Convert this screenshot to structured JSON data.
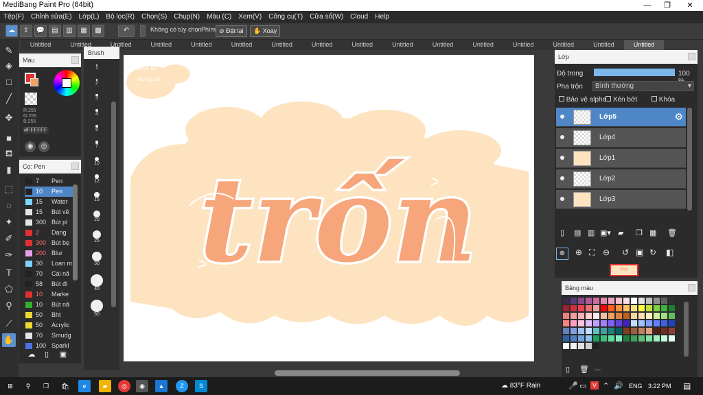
{
  "window": {
    "title": "MediBang Paint Pro (64bit)"
  },
  "menu": [
    "Tệp(F)",
    "Chỉnh sửa(E)",
    "Lớp(L)",
    "Bộ lọc(R)",
    "Chọn(S)",
    "Chụp(N)",
    "Màu (C)",
    "Xem(V)",
    "Công cụ(T)",
    "Cửa sổ(W)",
    "Cloud",
    "Help"
  ],
  "toolbar": {
    "snap_label": "Không có tùy chọn",
    "key_label": "Phím",
    "reset_label": "Đặt lại",
    "rotate_label": "Xoay"
  },
  "tabs": [
    "Untitled",
    "Untitled",
    "Untitled",
    "Untitled",
    "Untitled",
    "Untitled",
    "Untitled",
    "Untitled",
    "Untitled",
    "Untitled",
    "Untitled",
    "Untitled",
    "Untitled",
    "Untitled",
    "Untitled",
    "Untitled"
  ],
  "active_tab_index": 15,
  "color_panel": {
    "title": "Màu",
    "r": "R:255",
    "g": "G:255",
    "b": "B:255",
    "hex": "#FFFFFF"
  },
  "brush_panel": {
    "title": "Cọ: Pen",
    "items": [
      {
        "size": "7",
        "name": "Pen",
        "color": "#222222"
      },
      {
        "size": "10",
        "name": "Pen",
        "color": "#222222"
      },
      {
        "size": "15",
        "name": "Water",
        "color": "#7cd4ff"
      },
      {
        "size": "15",
        "name": "Bút vẽ",
        "color": "#e4e4e4"
      },
      {
        "size": "300",
        "name": "Bút pl",
        "color": "#e4e4e4"
      },
      {
        "size": "2",
        "name": "Dạng",
        "color": "#e03030"
      },
      {
        "size": "300",
        "name": "Bút bẹ",
        "color": "#e03030"
      },
      {
        "size": "200",
        "name": "Blur",
        "color": "#e8a0e8"
      },
      {
        "size": "30",
        "name": "Loan m",
        "color": "#7cd4ff"
      },
      {
        "size": "70",
        "name": "Cái nă",
        "color": "#222222"
      },
      {
        "size": "58",
        "name": "Bút đi",
        "color": "#222222"
      },
      {
        "size": "10",
        "name": "Marke",
        "color": "#e03030"
      },
      {
        "size": "10",
        "name": "Bút nă",
        "color": "#30b030"
      },
      {
        "size": "50",
        "name": "Bht",
        "color": "#e8d830"
      },
      {
        "size": "50",
        "name": "Acrylic",
        "color": "#e8d830"
      },
      {
        "size": "70",
        "name": "Smudg",
        "color": "#e4e4e4"
      },
      {
        "size": "100",
        "name": "Sparkl",
        "color": "#5070e0"
      }
    ]
  },
  "size_strip": {
    "title": "Brush",
    "sizes": [
      "1",
      "2",
      "3",
      "4",
      "5",
      "7",
      "10",
      "12",
      "15",
      "20",
      "25",
      "30",
      "40",
      "50"
    ]
  },
  "canvas": {
    "artwork_text": "trốn",
    "watermark_line1": "Phenix 03",
    "watermark_line2": "Hung 2k"
  },
  "layer_panel": {
    "title": "Lớp",
    "opacity_label": "Độ trong",
    "opacity_value": "100 %",
    "opacity_fraction": 1.0,
    "blend_label": "Pha trộn",
    "blend_value": "Bình thường",
    "protect_alpha": "Bảo vệ alpha",
    "clipping": "Xén bớt",
    "lock": "Khóa",
    "layers": [
      {
        "name": "Lớp5",
        "selected": true
      },
      {
        "name": "Lớp4",
        "selected": false
      },
      {
        "name": "Lớp1",
        "selected": false
      },
      {
        "name": "Lớp2",
        "selected": false
      },
      {
        "name": "Lớp3",
        "selected": false
      }
    ]
  },
  "nav_preview_label": "Pen",
  "palette_panel": {
    "title": "Bảng màu",
    "footer": "---"
  },
  "taskbar": {
    "weather": "83°F Rain",
    "lang": "ENG",
    "time": "3:22 PM"
  }
}
